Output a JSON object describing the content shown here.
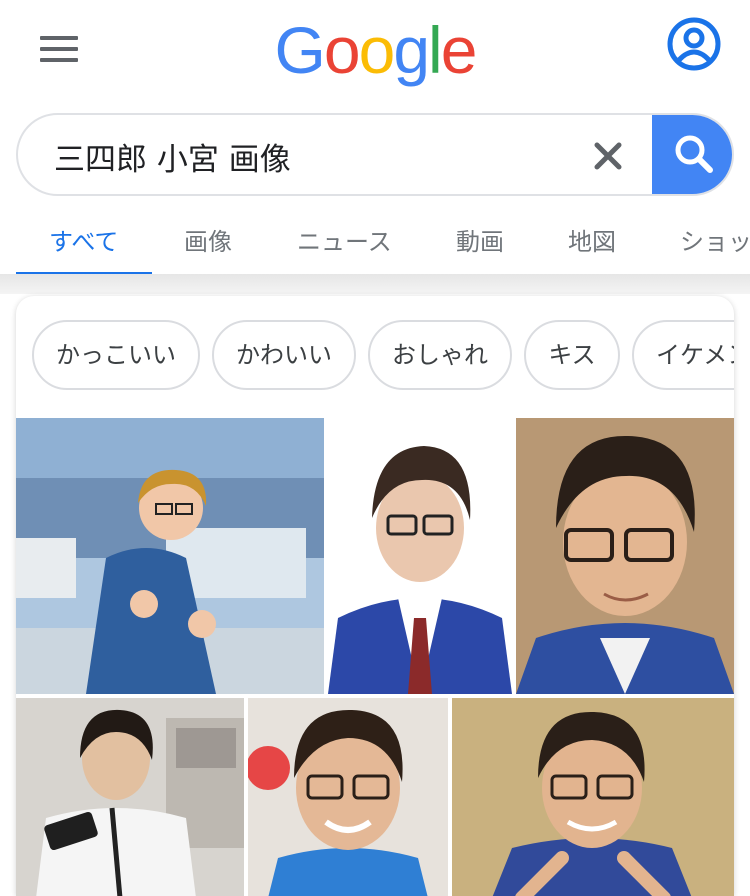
{
  "header": {
    "logo_letters": [
      {
        "ch": "G",
        "color": "#4285f4"
      },
      {
        "ch": "o",
        "color": "#ea4335"
      },
      {
        "ch": "o",
        "color": "#fbbc05"
      },
      {
        "ch": "g",
        "color": "#4285f4"
      },
      {
        "ch": "l",
        "color": "#34a853"
      },
      {
        "ch": "e",
        "color": "#ea4335"
      }
    ]
  },
  "search": {
    "query": "三四郎 小宮 画像"
  },
  "tabs": [
    {
      "label": "すべて",
      "active": true
    },
    {
      "label": "画像",
      "active": false
    },
    {
      "label": "ニュース",
      "active": false
    },
    {
      "label": "動画",
      "active": false
    },
    {
      "label": "地図",
      "active": false
    },
    {
      "label": "ショッ",
      "active": false
    }
  ],
  "chips": [
    "かっこいい",
    "かわいい",
    "おしゃれ",
    "キス",
    "イケメン"
  ],
  "colors": {
    "accent": "#1a73e8",
    "search_button": "#4285f4",
    "icon_gray": "#5f6368"
  },
  "images": [
    {
      "name": "result-image-1",
      "subject": "person in blue yukata pointing, stadium background"
    },
    {
      "name": "result-image-2",
      "subject": "man with glasses in blue suit, white background"
    },
    {
      "name": "result-image-3",
      "subject": "smiling man with glasses close-up"
    },
    {
      "name": "result-image-4",
      "subject": "man holding phone in room"
    },
    {
      "name": "result-image-5",
      "subject": "man with glasses smiling, blue shirt"
    },
    {
      "name": "result-image-6",
      "subject": "man with glasses gesturing, beige background"
    }
  ]
}
